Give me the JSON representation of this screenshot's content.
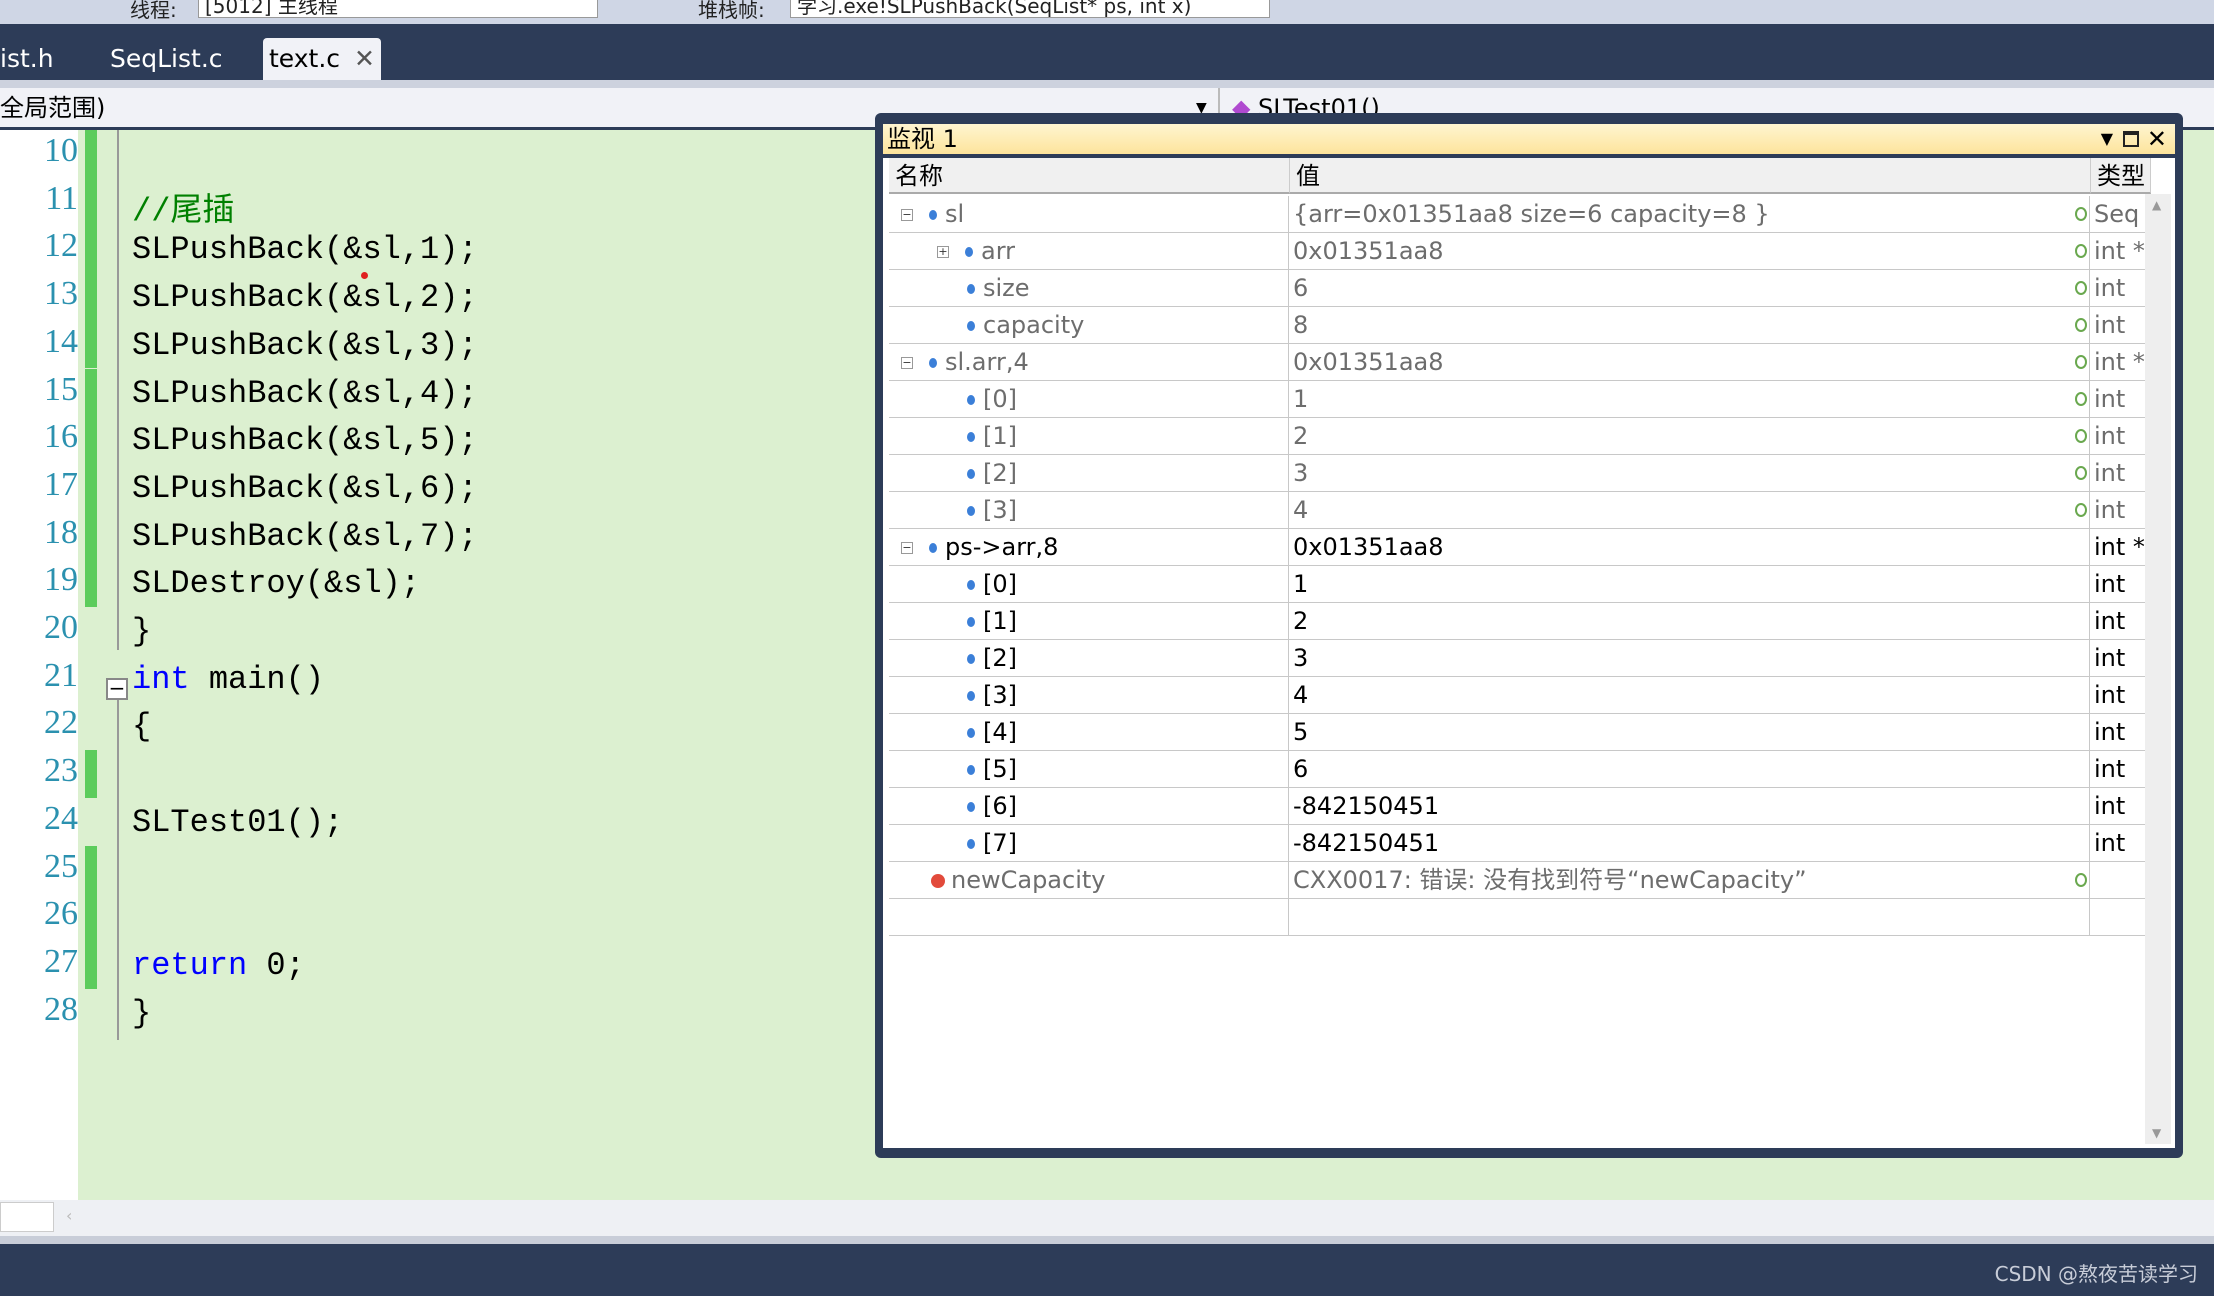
{
  "toolbar": {
    "thread_label": "线程:",
    "thread_value": "[5012] 主线程",
    "stack_label": "堆栈帧:",
    "stack_value": "学习.exe!SLPushBack(SeqList* ps, int x)"
  },
  "tabs": [
    {
      "label": "ist.h"
    },
    {
      "label": "SeqList.c"
    },
    {
      "label": "text.c",
      "active": true
    }
  ],
  "scope": {
    "left": "全局范围)",
    "right": "SLTest01()"
  },
  "editor": {
    "lines": [
      {
        "n": "10",
        "code": "",
        "type": "plain"
      },
      {
        "n": "11",
        "code": "//尾插",
        "type": "comment"
      },
      {
        "n": "12",
        "code": "SLPushBack(&sl,1);",
        "type": "plain"
      },
      {
        "n": "13",
        "code": "SLPushBack(&sl,2);",
        "type": "plain"
      },
      {
        "n": "14",
        "code": "SLPushBack(&sl,3);",
        "type": "plain"
      },
      {
        "n": "15",
        "code": "SLPushBack(&sl,4);",
        "type": "plain"
      },
      {
        "n": "16",
        "code": "SLPushBack(&sl,5);",
        "type": "plain"
      },
      {
        "n": "17",
        "code": "SLPushBack(&sl,6);",
        "type": "plain"
      },
      {
        "n": "18",
        "code": "SLPushBack(&sl,7);",
        "type": "plain"
      },
      {
        "n": "19",
        "code": "SLDestroy(&sl);",
        "type": "plain"
      },
      {
        "n": "20",
        "code": "}",
        "type": "plain"
      },
      {
        "n": "21",
        "code": "main()",
        "kw": "int ",
        "type": "kw"
      },
      {
        "n": "22",
        "code": "{",
        "type": "plain"
      },
      {
        "n": "23",
        "code": "",
        "type": "plain"
      },
      {
        "n": "24",
        "code": "SLTest01();",
        "type": "plain"
      },
      {
        "n": "25",
        "code": "",
        "type": "plain"
      },
      {
        "n": "26",
        "code": "",
        "type": "plain"
      },
      {
        "n": "27",
        "code": " 0;",
        "kw": "return",
        "type": "kw"
      },
      {
        "n": "28",
        "code": "}",
        "type": "plain"
      }
    ]
  },
  "watch": {
    "title": "监视 1",
    "columns": [
      "名称",
      "值",
      "类型"
    ],
    "rows": [
      {
        "name": "sl",
        "value": "{arr=0x01351aa8 size=6 capacity=8 }",
        "type": "Seq",
        "indent": 0,
        "toggle": "-",
        "gray": true
      },
      {
        "name": "arr",
        "value": "0x01351aa8",
        "type": "int *",
        "indent": 1,
        "toggle": "+",
        "gray": true
      },
      {
        "name": "size",
        "value": "6",
        "type": "int",
        "indent": 1,
        "gray": true
      },
      {
        "name": "capacity",
        "value": "8",
        "type": "int",
        "indent": 1,
        "gray": true
      },
      {
        "name": "sl.arr,4",
        "value": "0x01351aa8",
        "type": "int *",
        "indent": 0,
        "toggle": "-",
        "gray": true
      },
      {
        "name": "[0]",
        "value": "1",
        "type": "int",
        "indent": 1,
        "gray": true
      },
      {
        "name": "[1]",
        "value": "2",
        "type": "int",
        "indent": 1,
        "gray": true
      },
      {
        "name": "[2]",
        "value": "3",
        "type": "int",
        "indent": 1,
        "gray": true
      },
      {
        "name": "[3]",
        "value": "4",
        "type": "int",
        "indent": 1,
        "gray": true
      },
      {
        "name": "ps->arr,8",
        "value": "0x01351aa8",
        "type": "int *",
        "indent": 0,
        "toggle": "-"
      },
      {
        "name": "[0]",
        "value": "1",
        "type": "int",
        "indent": 1
      },
      {
        "name": "[1]",
        "value": "2",
        "type": "int",
        "indent": 1
      },
      {
        "name": "[2]",
        "value": "3",
        "type": "int",
        "indent": 1
      },
      {
        "name": "[3]",
        "value": "4",
        "type": "int",
        "indent": 1
      },
      {
        "name": "[4]",
        "value": "5",
        "type": "int",
        "indent": 1
      },
      {
        "name": "[5]",
        "value": "6",
        "type": "int",
        "indent": 1
      },
      {
        "name": "[6]",
        "value": "-842150451",
        "type": "int",
        "indent": 1
      },
      {
        "name": "[7]",
        "value": "-842150451",
        "type": "int",
        "indent": 1
      },
      {
        "name": "newCapacity",
        "value": "CXX0017: 错误: 没有找到符号“newCapacity”",
        "type": "",
        "indent": 0,
        "error": true,
        "gray": true
      }
    ]
  },
  "footer": {
    "watermark": "CSDN @熬夜苦读学习"
  }
}
